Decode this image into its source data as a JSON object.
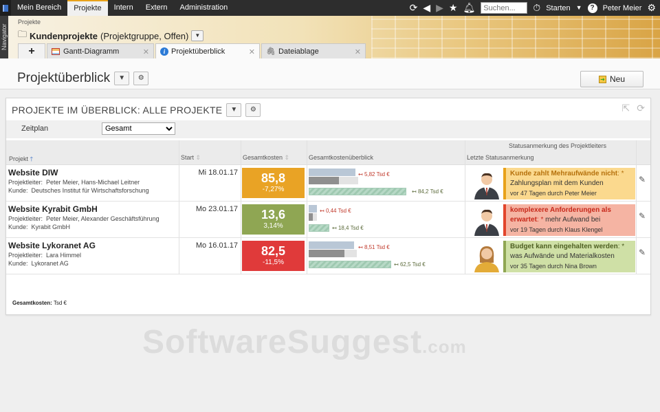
{
  "nav": {
    "items": [
      "Mein Bereich",
      "Projekte",
      "Intern",
      "Extern",
      "Administration"
    ],
    "active": 1,
    "search_placeholder": "Suchen...",
    "starten": "Starten",
    "user": "Peter Meier"
  },
  "navigator_label": "Navigator",
  "header": {
    "crumb": "Projekte",
    "title_bold": "Kundenprojekte",
    "title_rest": "(Projektgruppe, Offen)"
  },
  "tabs": [
    {
      "label": "Gantt-Diagramm"
    },
    {
      "label": "Projektüberblick"
    },
    {
      "label": "Dateiablage"
    }
  ],
  "page": {
    "title": "Projektüberblick",
    "new_label": "Neu"
  },
  "panel": {
    "title": "PROJEKTE IM ÜBERBLICK: ALLE PROJEKTE",
    "filter_label": "Zeitplan",
    "filter_value": "Gesamt",
    "group_header": "Statusanmerkung des Projektleiters",
    "columns": {
      "projekt": "Projekt",
      "start": "Start",
      "kosten": "Gesamtkosten",
      "ueberblick": "Gesamtkostenüberblick",
      "status": "Letzte Statusanmerkung"
    },
    "footer_label": "Gesamtkosten:",
    "footer_unit": "Tsd €"
  },
  "rows": [
    {
      "name": "Website DIW",
      "leiter_label": "Projektleiter:",
      "leiter": "Peter Meier, Hans-Michael Leitner",
      "kunde_label": "Kunde:",
      "kunde": "Deutsches Institut für Wirtschaftsforschung",
      "start": "Mi 18.01.17",
      "cost": "85,8",
      "delta": "-7,27%",
      "color": "#e9a325",
      "bar_top_label": "5,82 Tsd €",
      "bar_bottom_label": "84,2 Tsd €",
      "note_color": "#fbd98e",
      "note_border": "#e8a21a",
      "note_head": "Kunde zahlt Mehraufwände nicht",
      "note_head_color": "#b5700b",
      "note_body": "Zahlungsplan mit dem Kunden",
      "note_ago": "vor 47 Tagen durch Peter Meier",
      "avatar": "male"
    },
    {
      "name": "Website Kyrabit GmbH",
      "leiter_label": "Projektleiter:",
      "leiter": "Peter Meier, Alexander Geschäftsführung",
      "kunde_label": "Kunde:",
      "kunde": "Kyrabit GmbH",
      "start": "Mo 23.01.17",
      "cost": "13,6",
      "delta": "3,14%",
      "color": "#8fa653",
      "bar_top_label": "0,44 Tsd €",
      "bar_bottom_label": "18,4 Tsd €",
      "note_color": "#f5b4a3",
      "note_border": "#e2452c",
      "note_head": "komplexere Anforderungen als erwartet",
      "note_head_color": "#c7281a",
      "note_body": "mehr Aufwand bei",
      "note_ago": "vor 19 Tagen durch Klaus Klengel",
      "avatar": "male"
    },
    {
      "name": "Website Lykoranet AG",
      "leiter_label": "Projektleiter:",
      "leiter": "Lara Himmel",
      "kunde_label": "Kunde:",
      "kunde": "Lykoranet AG",
      "start": "Mo 16.01.17",
      "cost": "82,5",
      "delta": "-11,5%",
      "color": "#e03a3a",
      "bar_top_label": "8,51 Tsd €",
      "bar_bottom_label": "62,5 Tsd €",
      "note_color": "#cfe0a6",
      "note_border": "#8fa653",
      "note_head": "Budget kann eingehalten werden",
      "note_head_color": "#4e5f22",
      "note_body": "was Aufwände und Materialkosten",
      "note_ago": "vor 35 Tagen durch Nina Brown",
      "avatar": "female"
    }
  ],
  "watermark": {
    "main": "SoftwareSuggest",
    "suffix": ".com"
  }
}
